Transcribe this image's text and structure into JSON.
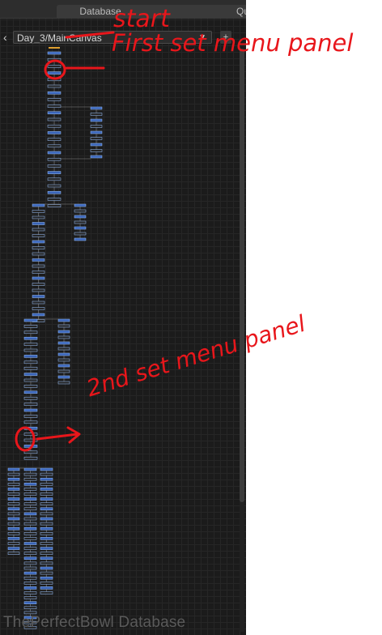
{
  "tabs": [
    {
      "label": "Database"
    },
    {
      "label": ""
    },
    {
      "label": "Qu"
    }
  ],
  "path": {
    "back_glyph": "‹",
    "value": "Day_3/MainCanvas",
    "plus_glyph": "+"
  },
  "watermark": "ThePerfectBowl Database",
  "annotations": {
    "start": "start",
    "first_panel": "First set menu panel",
    "second_panel": "2nd set menu panel"
  },
  "colors": {
    "canvas_bg": "#1b1b1b",
    "node_blue": "#3a64b8",
    "node_dark": "#262626",
    "annotation_red": "#e8161b"
  },
  "icons": {
    "back": "chevron-left-icon",
    "dropdown": "dropdown-triangle-icon",
    "add": "plus-icon"
  }
}
